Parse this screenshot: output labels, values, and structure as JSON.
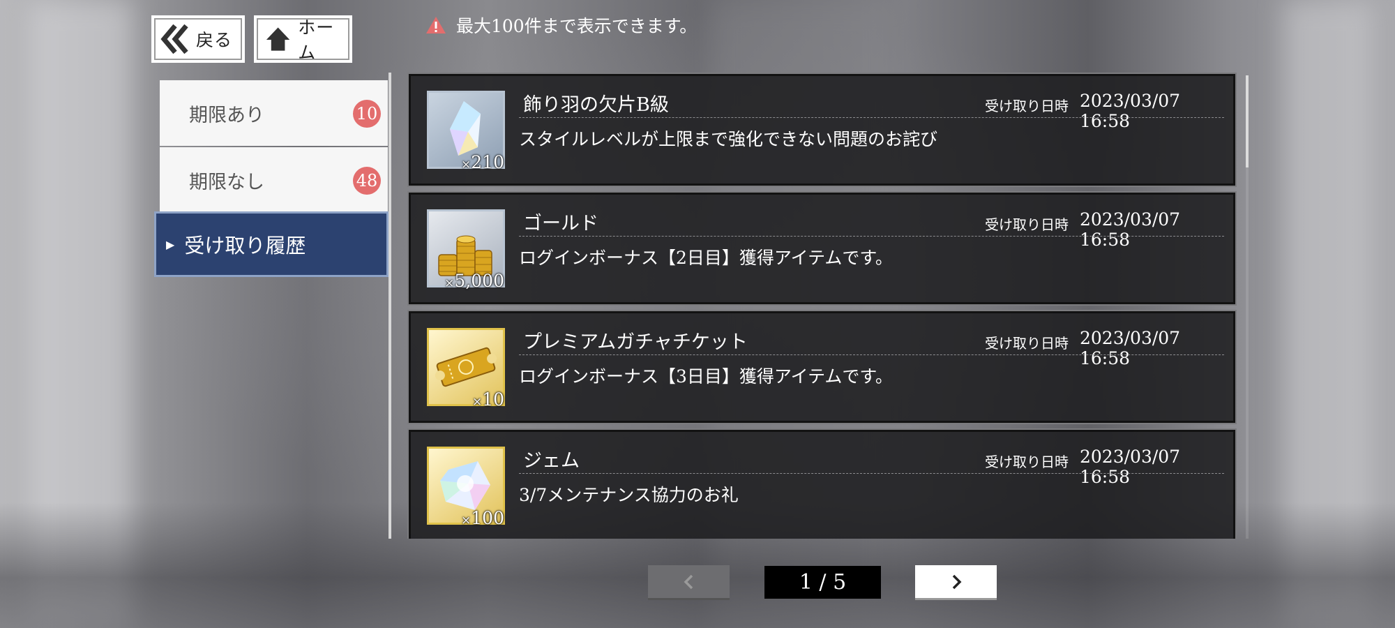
{
  "nav": {
    "back_label": "戻る",
    "home_label": "ホーム"
  },
  "notice": {
    "text": "最大100件まで表示できます。",
    "icon": "warning-icon",
    "color": "#e36d6d"
  },
  "sidebar": {
    "items": [
      {
        "label": "期限あり",
        "badge": "10"
      },
      {
        "label": "期限なし",
        "badge": "48"
      },
      {
        "label": "受け取り履歴",
        "active": true
      }
    ],
    "active_color": "#2c4270",
    "badge_color": "#e36d6d"
  },
  "history": {
    "items": [
      {
        "icon": "feather-shard-icon",
        "qty_prefix": "×",
        "qty": "210",
        "title": "飾り羽の欠片B級",
        "received_label": "受け取り日時",
        "received_at": "2023/03/07 16:58",
        "description": "スタイルレベルが上限まで強化できない問題のお詫び"
      },
      {
        "icon": "gold-coins-icon",
        "qty_prefix": "×",
        "qty": "5,000",
        "title": "ゴールド",
        "received_label": "受け取り日時",
        "received_at": "2023/03/07 16:58",
        "description": "ログインボーナス【2日目】獲得アイテムです。"
      },
      {
        "icon": "gacha-ticket-icon",
        "qty_prefix": "×",
        "qty": "10",
        "title": "プレミアムガチャチケット",
        "received_label": "受け取り日時",
        "received_at": "2023/03/07 16:58",
        "description": "ログインボーナス【3日目】獲得アイテムです。"
      },
      {
        "icon": "gem-icon",
        "qty_prefix": "×",
        "qty": "100",
        "title": "ジェム",
        "received_label": "受け取り日時",
        "received_at": "2023/03/07 16:58",
        "description": "3/7メンテナンス協力のお礼"
      }
    ]
  },
  "pagination": {
    "indicator": "1 / 5",
    "prev_icon": "chevron-left-icon",
    "next_icon": "chevron-right-icon"
  }
}
